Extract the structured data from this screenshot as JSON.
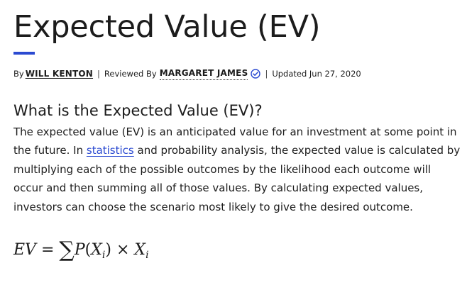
{
  "article": {
    "title": "Expected Value (EV)",
    "byline": {
      "by_prefix": "By",
      "author": "WILL KENTON",
      "reviewed_prefix": "Reviewed By",
      "reviewer": "MARGARET JAMES",
      "updated": "Updated Jun 27, 2020",
      "separator": "|"
    },
    "section_heading": "What is the Expected Value (EV)?",
    "paragraph": {
      "line1": "The expected value (EV) is an anticipated value for an investment at some point in",
      "line2_before_link": "the future. In ",
      "link_text": "statistics",
      "line2_after_link": " and probability analysis, the expected value is calculated by",
      "line3": "multiplying each of the possible outcomes by the likelihood each outcome will",
      "line4": "occur and then summing all of those values. By calculating expected values,",
      "line5": "investors can choose the scenario most likely to give the desired outcome."
    },
    "formula": {
      "lhs": "EV",
      "equals": "=",
      "sum": "∑",
      "p": "P",
      "open": "(",
      "x": "X",
      "sub": "i",
      "close": ")",
      "times": "×",
      "x2": "X",
      "sub2": "i"
    }
  },
  "colors": {
    "accent": "#2b4ad1",
    "text": "#1c1c1c"
  },
  "icons": {
    "verified": "check-circle-icon"
  }
}
